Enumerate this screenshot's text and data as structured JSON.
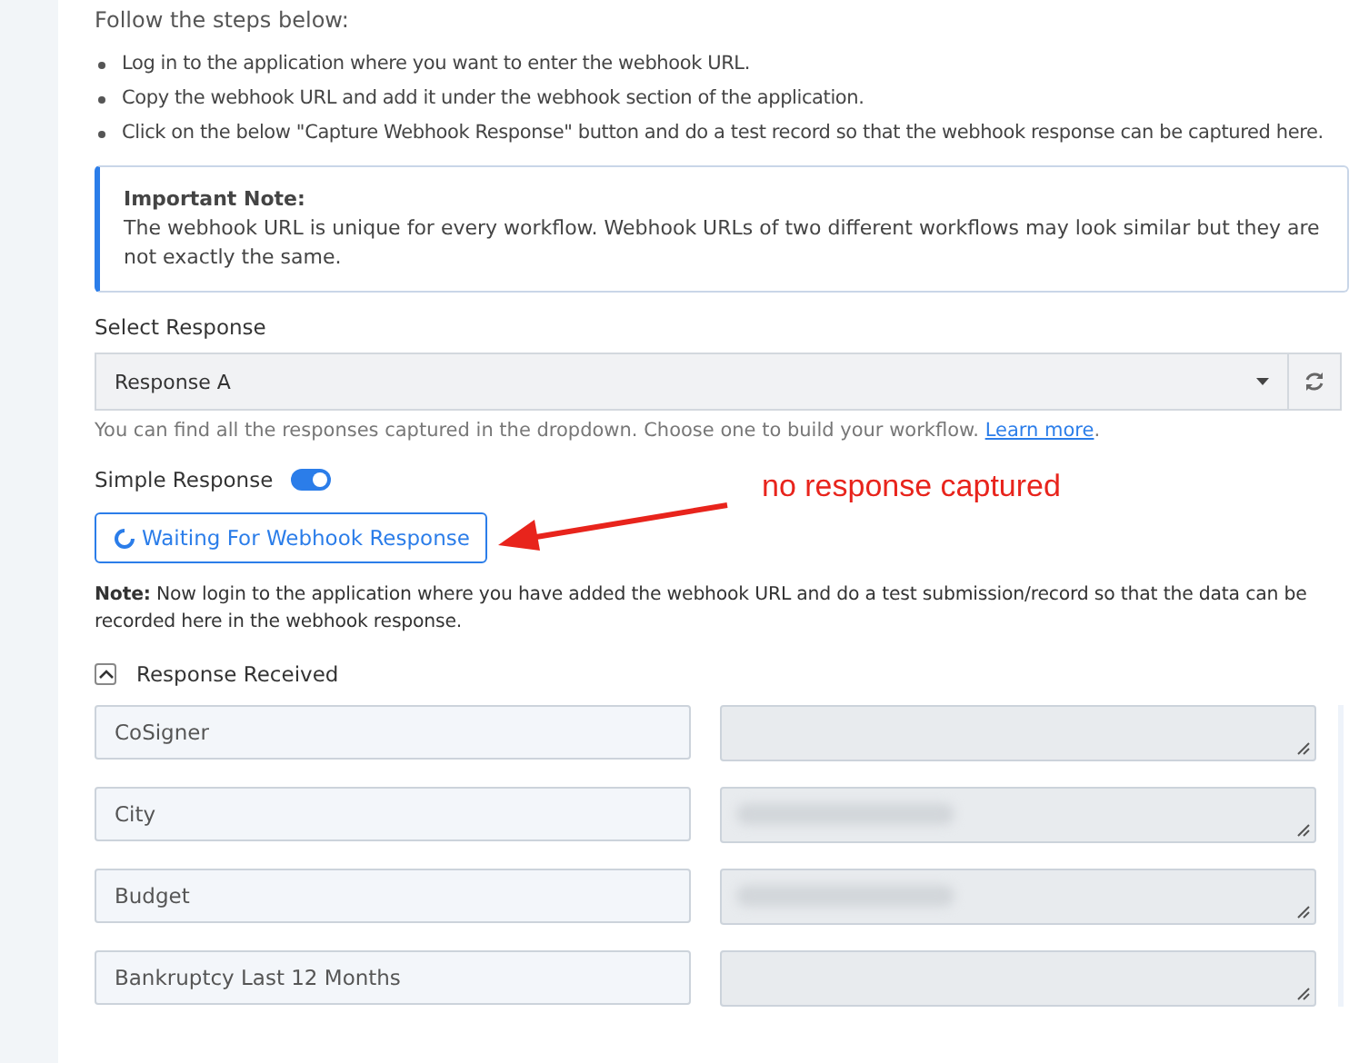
{
  "intro": "Follow the steps below:",
  "steps": [
    "Log in to the application where you want to enter the webhook URL.",
    "Copy the webhook URL and add it under the webhook section of the application.",
    "Click on the below \"Capture Webhook Response\" button and do a test record so that the webhook response can be captured here."
  ],
  "important_note": {
    "title": "Important Note:",
    "text": "The webhook URL is unique for every workflow. Webhook URLs of two different workflows may look similar but they are not exactly the same."
  },
  "select_response": {
    "label": "Select Response",
    "value": "Response A",
    "help": "You can find all the responses captured in the dropdown. Choose one to build your workflow.",
    "help_link": "Learn more",
    "help_end": "."
  },
  "simple_response": {
    "label": "Simple Response",
    "on": true
  },
  "capture_button": {
    "label": "Waiting For Webhook Response",
    "waiting": true
  },
  "annotation": "no response captured",
  "note": "**Note:** Now login to the application where you have added the webhook URL and do a test submission/record so that the data can be recorded here in the webhook response.",
  "response_received": {
    "label": "Response Received",
    "expanded": true,
    "fields": [
      {
        "name": "CoSigner",
        "redacted": false
      },
      {
        "name": "City",
        "redacted": true
      },
      {
        "name": "Budget",
        "redacted": true
      },
      {
        "name": "Bankruptcy Last 12 Months",
        "redacted": false
      }
    ]
  }
}
